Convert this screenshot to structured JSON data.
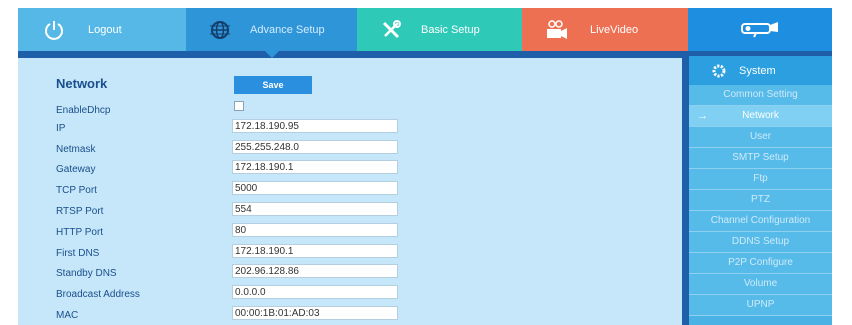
{
  "topbar": {
    "tabs": [
      {
        "label": "Logout",
        "icon": "power-icon"
      },
      {
        "label": "Advance Setup",
        "icon": "globe-icon"
      },
      {
        "label": "Basic Setup",
        "icon": "tools-icon"
      },
      {
        "label": "LiveVideo",
        "icon": "video-camera-icon"
      },
      {
        "label": "",
        "icon": "camera-logo-icon"
      }
    ]
  },
  "network": {
    "title": "Network",
    "save_label": "Save",
    "fields": [
      {
        "label": "EnableDhcp",
        "type": "checkbox",
        "checked": false
      },
      {
        "label": "IP",
        "value": "172.18.190.95"
      },
      {
        "label": "Netmask",
        "value": "255.255.248.0"
      },
      {
        "label": "Gateway",
        "value": "172.18.190.1"
      },
      {
        "label": "TCP Port",
        "value": "5000"
      },
      {
        "label": "RTSP Port",
        "value": "554"
      },
      {
        "label": "HTTP Port",
        "value": "80"
      },
      {
        "label": "First DNS",
        "value": "172.18.190.1"
      },
      {
        "label": "Standby DNS",
        "value": "202.96.128.86"
      },
      {
        "label": "Broadcast Address",
        "value": "0.0.0.0"
      },
      {
        "label": "MAC",
        "value": "00:00:1B:01:AD:03"
      }
    ]
  },
  "sidebar": {
    "header": "System",
    "active": "Network",
    "items": [
      "Common Setting",
      "Network",
      "User",
      "SMTP Setup",
      "Ftp",
      "PTZ",
      "Channel Configuration",
      "DDNS Setup",
      "P2P Configure",
      "Volume",
      "UPNP"
    ]
  },
  "colors": {
    "accent": "#2f95d9",
    "panel": "#c6e7f9",
    "sidebar": "#4bb2e6",
    "logout": "#55b8e6",
    "basic": "#2fc9b8",
    "live": "#ee7052"
  }
}
